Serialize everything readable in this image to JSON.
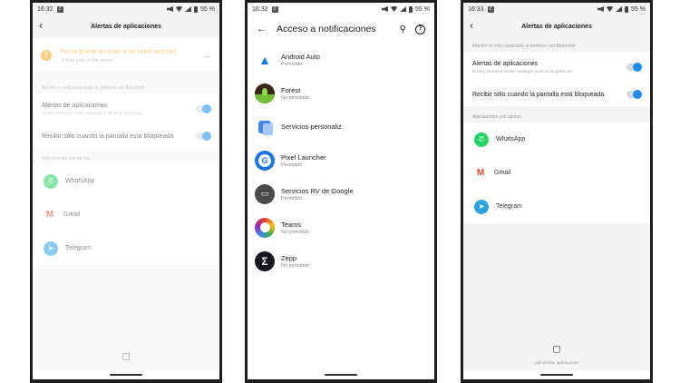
{
  "screen1": {
    "status": {
      "time": "16:32",
      "badge": "Z",
      "battery": "55 %"
    },
    "title": "Alertas de aplicaciones",
    "warning": {
      "title": "No se puede acceder a las notificaciones",
      "subtitle": "Activar para recibir alertas"
    },
    "section_bt": "Mantén el reloj conectado al teléfono con Bluetooth",
    "alerts": {
      "label": "Alertas de aplicaciones",
      "desc": "El reloj vibrará al recibir mensajes push de la aplicación"
    },
    "locked": {
      "label": "Recibir sólo cuando la pantalla está bloqueada"
    },
    "section_apps": "Aplicaciones con alertas",
    "apps": [
      "WhatsApp",
      "Gmail",
      "Telegram"
    ]
  },
  "screen2": {
    "status": {
      "time": "16:32",
      "badge": "Z",
      "battery": "55 %"
    },
    "title": "Acceso a notificaciones",
    "items": [
      {
        "name": "Android Auto",
        "status": "Permitido"
      },
      {
        "name": "Forest",
        "status": "No permitido"
      },
      {
        "name": "Servicios personaliz.",
        "status": ""
      },
      {
        "name": "Pixel Launcher",
        "status": "Permitido"
      },
      {
        "name": "Servicios RV de Google",
        "status": "Permitido"
      },
      {
        "name": "Teams",
        "status": "No permitido"
      },
      {
        "name": "Zepp",
        "status": "No permitido"
      }
    ]
  },
  "screen3": {
    "status": {
      "time": "16:33",
      "badge": "Z",
      "battery": "55 %"
    },
    "title": "Alertas de aplicaciones",
    "section_bt": "Mantén el reloj conectado al teléfono con Bluetooth",
    "alerts": {
      "label": "Alertas de aplicaciones",
      "desc": "El reloj vibrará al recibir mensajes push de la aplicación"
    },
    "locked": {
      "label": "Recibir sólo cuando la pantalla está bloqueada"
    },
    "section_apps": "Aplicaciones con alertas",
    "apps": [
      "WhatsApp",
      "Gmail",
      "Telegram"
    ],
    "manage_label": "Administrar aplicaciones"
  },
  "icons": {
    "back": "back-arrow-icon",
    "warning": "warning-icon",
    "chevron": "chevron-right-icon",
    "search": "search-icon",
    "help": "help-icon",
    "grid": "grid-icon"
  },
  "colors": {
    "accent": "#1e8bf0",
    "warning": "#f5a623",
    "whatsapp": "#25d366",
    "telegram": "#2aa3de"
  }
}
